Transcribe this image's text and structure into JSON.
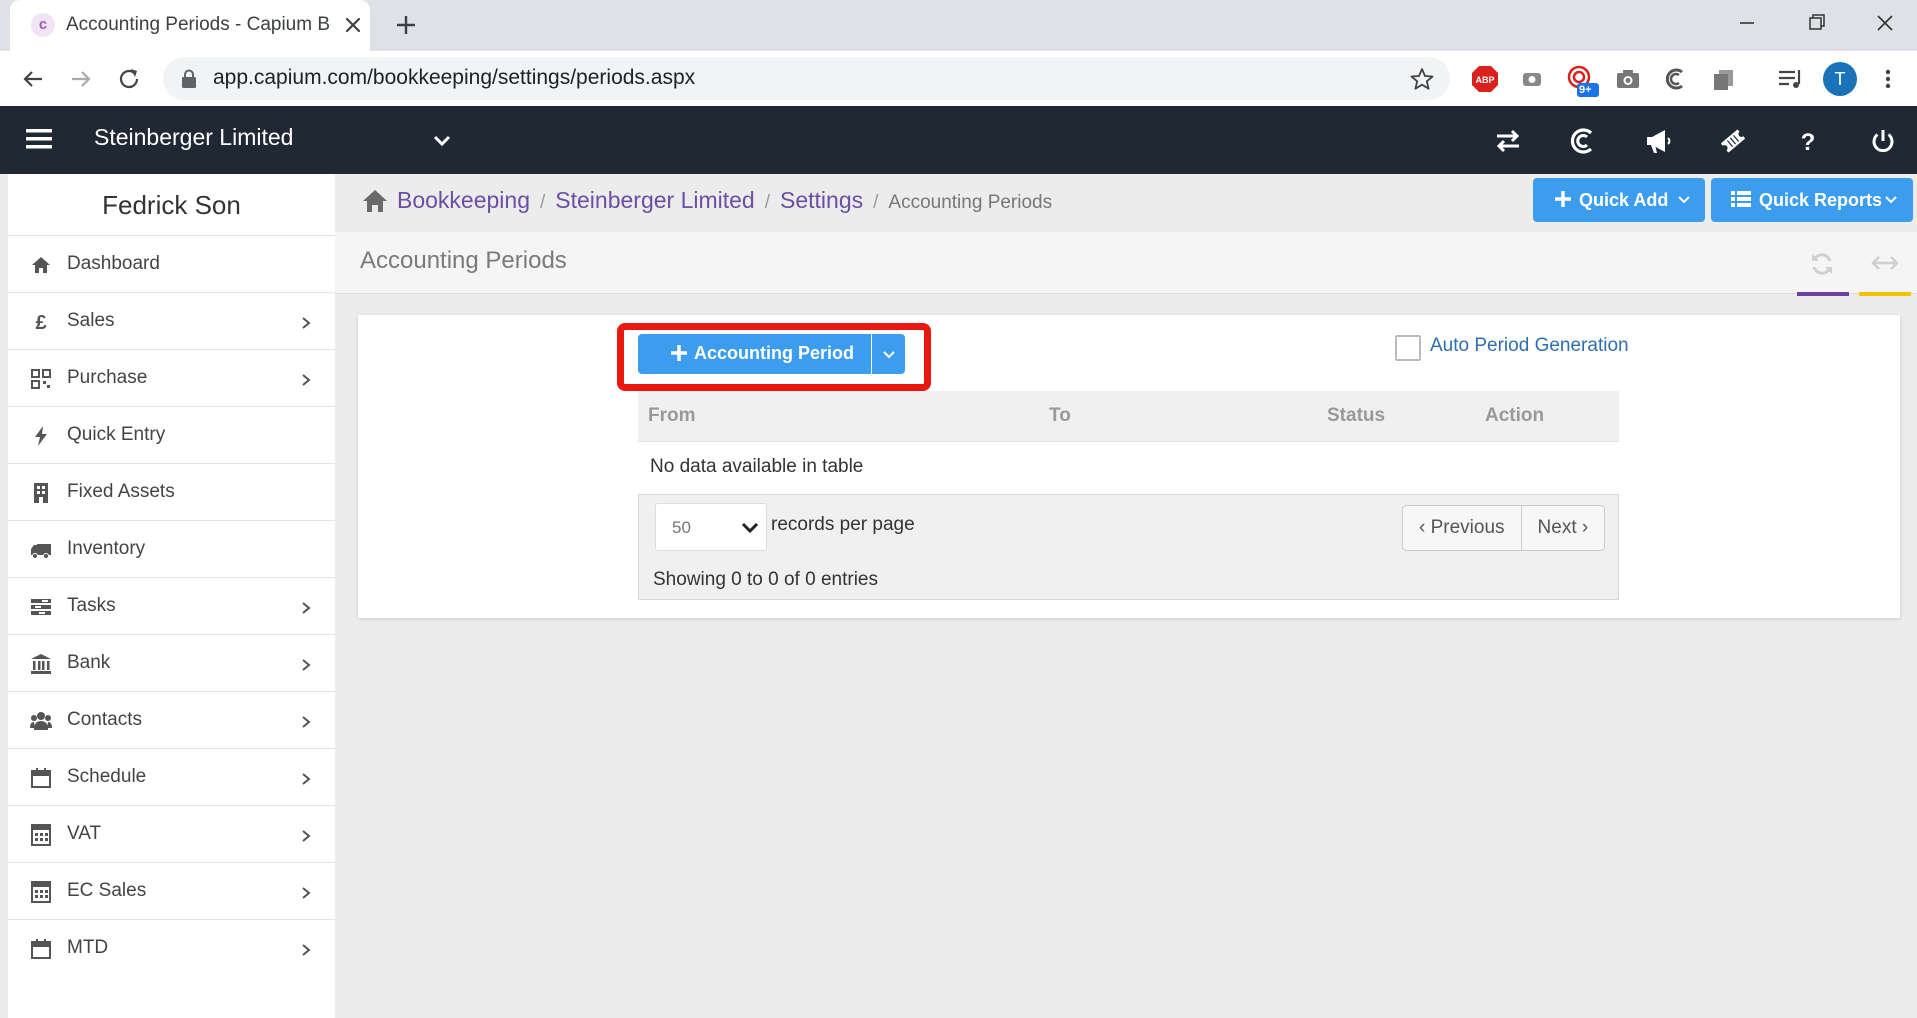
{
  "browser": {
    "tab_title": "Accounting Periods - Capium Bo",
    "url": "app.capium.com/bookkeeping/settings/periods.aspx",
    "profile_initial": "T",
    "ext_badge": "9+"
  },
  "app": {
    "company_name": "Steinberger Limited"
  },
  "sidebar": {
    "user_name": "Fedrick Son",
    "items": [
      {
        "label": "Dashboard",
        "icon": "home-icon",
        "has_submenu": false
      },
      {
        "label": "Sales",
        "icon": "pound-icon",
        "has_submenu": true
      },
      {
        "label": "Purchase",
        "icon": "qrcode-icon",
        "has_submenu": true
      },
      {
        "label": "Quick Entry",
        "icon": "bolt-icon",
        "has_submenu": false
      },
      {
        "label": "Fixed Assets",
        "icon": "building-icon",
        "has_submenu": false
      },
      {
        "label": "Inventory",
        "icon": "truck-icon",
        "has_submenu": false
      },
      {
        "label": "Tasks",
        "icon": "tasks-icon",
        "has_submenu": true
      },
      {
        "label": "Bank",
        "icon": "bank-icon",
        "has_submenu": true
      },
      {
        "label": "Contacts",
        "icon": "users-icon",
        "has_submenu": true
      },
      {
        "label": "Schedule",
        "icon": "calendar-icon",
        "has_submenu": true
      },
      {
        "label": "VAT",
        "icon": "calculator-icon",
        "has_submenu": true
      },
      {
        "label": "EC Sales",
        "icon": "calculator-icon",
        "has_submenu": true
      },
      {
        "label": "MTD",
        "icon": "calendar-icon",
        "has_submenu": true
      }
    ]
  },
  "breadcrumb": {
    "items": [
      "Bookkeeping",
      "Steinberger Limited",
      "Settings"
    ],
    "current": "Accounting Periods"
  },
  "header_buttons": {
    "quick_add": "Quick Add",
    "quick_reports": "Quick Reports"
  },
  "page": {
    "title": "Accounting Periods"
  },
  "main": {
    "add_button": "Accounting Period",
    "auto_period_label": "Auto Period Generation",
    "auto_period_checked": false,
    "columns": [
      "From",
      "To",
      "Status",
      "Action"
    ],
    "empty_message": "No data available in table",
    "page_size": "50",
    "records_per_page": "records per page",
    "prev": "Previous",
    "next": "Next",
    "showing": "Showing 0 to 0 of 0 entries"
  },
  "colors": {
    "primary_button": "#3c9dee",
    "header_bg": "#1f2833",
    "highlight": "#e8170f",
    "link": "#6a4fa3"
  }
}
